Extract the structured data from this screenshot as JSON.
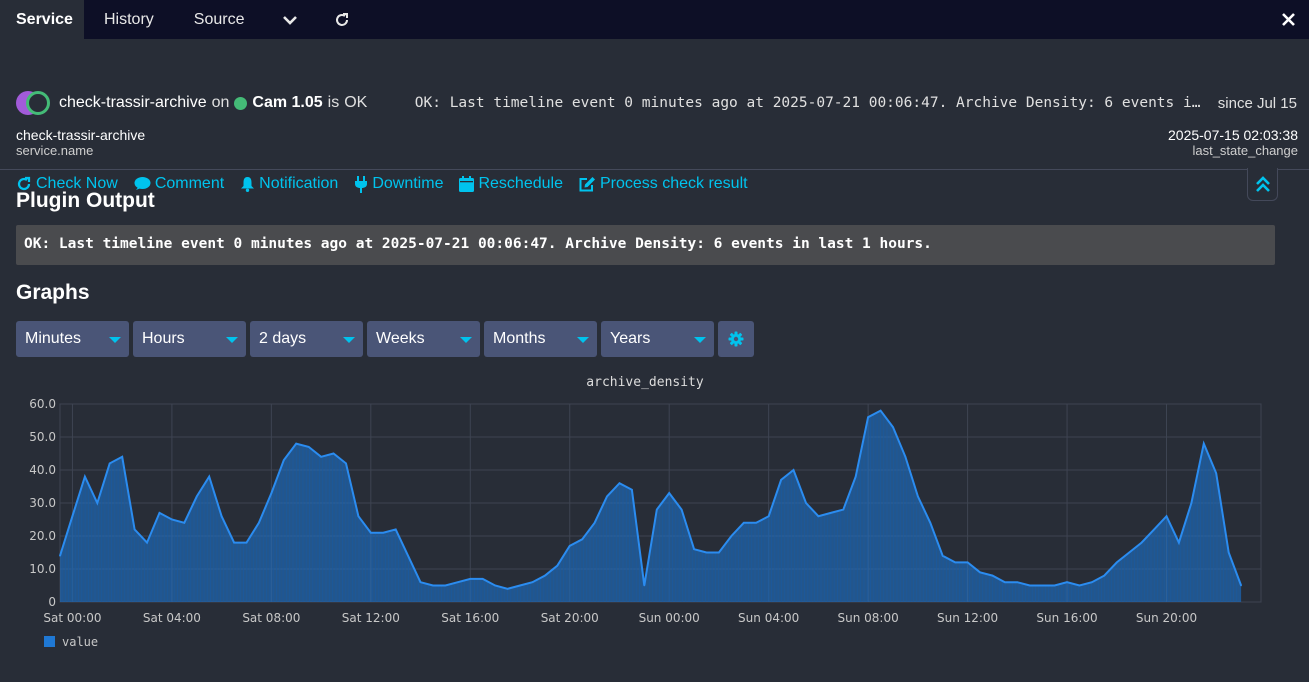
{
  "tabs": [
    {
      "label": "Service",
      "active": true
    },
    {
      "label": "History",
      "active": false
    },
    {
      "label": "Source",
      "active": false
    }
  ],
  "tab_icons": [
    "chevron-down-icon",
    "refresh-icon",
    "close-icon"
  ],
  "service": {
    "name": "check-trassir-archive",
    "on_label": "on",
    "host": "Cam 1.05",
    "is_label": "is",
    "state": "OK",
    "header_output": "OK: Last timeline event 0 minutes ago at 2025-07-21 00:06:47. Archive Density: 6 events in last 1 hours.",
    "since": "since Jul 15",
    "name_value": "check-trassir-archive",
    "name_key": "service.name",
    "last_change_value": "2025-07-15 02:03:38",
    "last_change_key": "last_state_change"
  },
  "colors": {
    "state_ok": "#44bb77",
    "state_unknown": "#a25bd9",
    "accent": "#00c3ed",
    "series": "#1f78d4"
  },
  "actions": [
    {
      "label": "Check Now",
      "icon": "refresh-icon"
    },
    {
      "label": "Comment",
      "icon": "comment-icon"
    },
    {
      "label": "Notification",
      "icon": "bell-icon"
    },
    {
      "label": "Downtime",
      "icon": "plug-icon"
    },
    {
      "label": "Reschedule",
      "icon": "calendar-icon"
    },
    {
      "label": "Process check result",
      "icon": "edit-icon"
    }
  ],
  "plugin_output": {
    "heading": "Plugin Output",
    "text": "OK: Last timeline event 0 minutes ago at 2025-07-21 00:06:47. Archive Density: 6 events in last 1 hours."
  },
  "graphs": {
    "heading": "Graphs",
    "selects": [
      "Minutes",
      "Hours",
      "2 days",
      "Weeks",
      "Months",
      "Years"
    ]
  },
  "chart_data": {
    "type": "area",
    "title": "archive_density",
    "xlabel": "",
    "ylabel": "",
    "yticks": [
      "0",
      "10.0",
      "20.0",
      "30.0",
      "40.0",
      "50.0",
      "60.0"
    ],
    "ylim": [
      0,
      60
    ],
    "xticks": [
      "Sat 00:00",
      "Sat 04:00",
      "Sat 08:00",
      "Sat 12:00",
      "Sat 16:00",
      "Sat 20:00",
      "Sun 00:00",
      "Sun 04:00",
      "Sun 08:00",
      "Sun 12:00",
      "Sun 16:00",
      "Sun 20:00"
    ],
    "x_hours": [
      -0.5,
      0,
      0.5,
      1,
      1.5,
      2,
      2.5,
      3,
      3.5,
      4,
      4.5,
      5,
      5.5,
      6,
      6.5,
      7,
      7.5,
      8,
      8.5,
      9,
      9.5,
      10,
      10.5,
      11,
      11.5,
      12,
      12.5,
      13,
      13.5,
      14,
      14.5,
      15,
      15.5,
      16,
      16.5,
      17,
      17.5,
      18,
      18.5,
      19,
      19.5,
      20,
      20.5,
      21,
      21.5,
      22,
      22.5,
      23,
      23.5,
      24,
      24.5,
      25,
      25.5,
      26,
      26.5,
      27,
      27.5,
      28,
      28.5,
      29,
      29.5,
      30,
      30.5,
      31,
      31.5,
      32,
      32.5,
      33,
      33.5,
      34,
      34.5,
      35,
      35.5,
      36,
      36.5,
      37,
      37.5,
      38,
      38.5,
      39,
      39.5,
      40,
      40.5,
      41,
      41.5,
      42,
      42.5,
      43,
      43.5,
      44,
      44.5,
      45,
      45.5,
      46,
      46.5,
      47,
      47.5,
      47.8
    ],
    "series": [
      {
        "name": "value",
        "values": [
          14,
          26,
          38,
          30,
          42,
          44,
          22,
          18,
          27,
          25,
          24,
          32,
          38,
          26,
          18,
          18,
          24,
          33,
          43,
          48,
          47,
          44,
          45,
          42,
          26,
          21,
          21,
          22,
          14,
          6,
          5,
          5,
          6,
          7,
          7,
          5,
          4,
          5,
          6,
          8,
          11,
          17,
          19,
          24,
          32,
          36,
          34,
          5,
          28,
          33,
          28,
          16,
          15,
          15,
          20,
          24,
          24,
          26,
          37,
          40,
          30,
          26,
          27,
          28,
          38,
          56,
          58,
          53,
          44,
          32,
          24,
          14,
          12,
          12,
          9,
          8,
          6,
          6,
          5,
          5,
          5,
          6,
          5,
          6,
          8,
          12,
          15,
          18,
          22,
          26,
          18,
          30,
          48,
          39,
          15,
          5
        ],
        "legend": "value"
      }
    ],
    "grid": true,
    "legend_position": "bottom-left"
  }
}
